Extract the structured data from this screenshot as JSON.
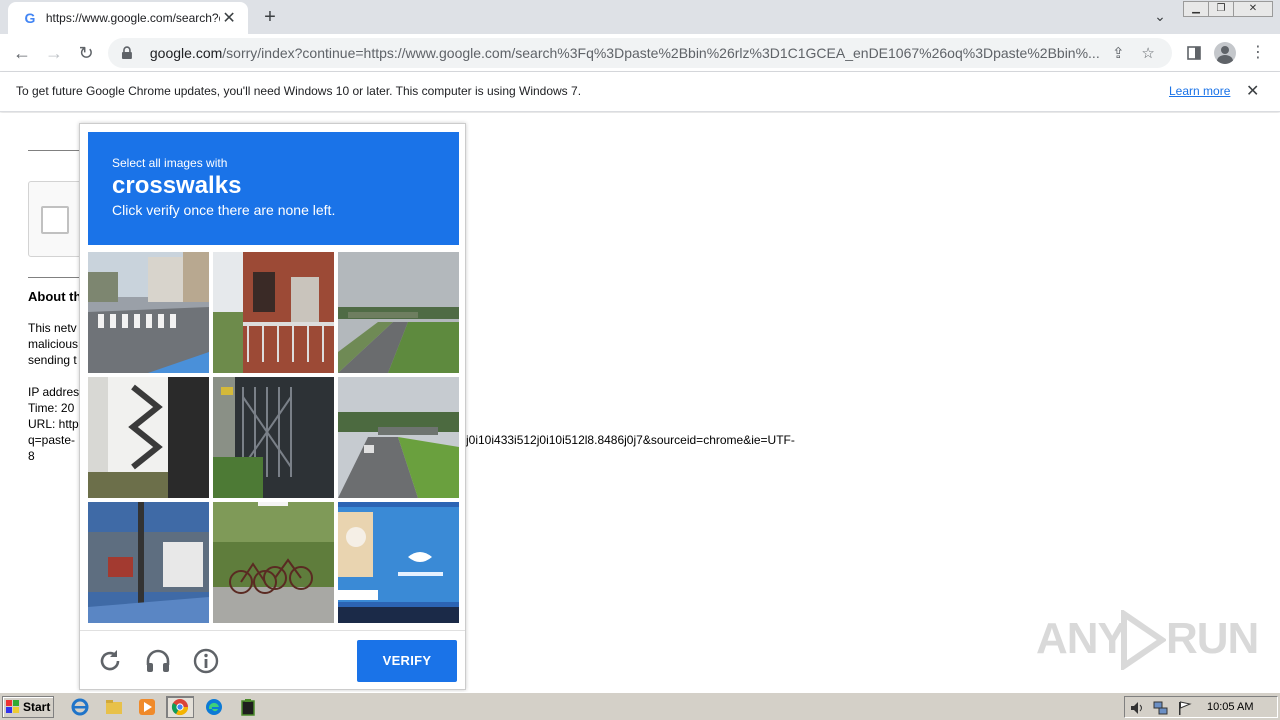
{
  "browser": {
    "tab": {
      "title": "https://www.google.com/search?q=",
      "favicon": "G"
    },
    "url": {
      "host": "google.com",
      "path": "/sorry/index?continue=https://www.google.com/search%3Fq%3Dpaste%2Bbin%26rlz%3D1C1GCEA_enDE1067%26oq%3Dpaste%2Bbin%..."
    },
    "window_controls": [
      "minimize-icon",
      "restore-icon",
      "close-icon"
    ]
  },
  "infobar": {
    "message": "To get future Google Chrome updates, you'll need Windows 10 or later. This computer is using Windows 7.",
    "link": "Learn more"
  },
  "background_page": {
    "about_heading": "About th",
    "lines": [
      "This netv",
      "malicious",
      "sending t"
    ],
    "ip_label": "IP addres",
    "time_label": "Time: 20",
    "url_label": "URL: http",
    "url_line2_left": "q=paste-",
    "url_line2_right": "j0i10i433i512j0i10i512l8.8486j0j7&sourceid=chrome&ie=UTF-",
    "url_line3": "8"
  },
  "challenge": {
    "instruction": "Select all images with",
    "keyword": "crosswalks",
    "subtext": "Click verify once there are none left.",
    "tiles": [
      "street-crosswalk",
      "brick-building-balcony",
      "highway-overpass",
      "building-exterior-stairs",
      "metal-gate",
      "highway-road",
      "street-with-truck",
      "parked-bicycles",
      "delivery-truck"
    ],
    "verify_label": "VERIFY"
  },
  "watermark": {
    "text_left": "ANY",
    "text_right": "RUN"
  },
  "taskbar": {
    "start_label": "Start",
    "clock": "10:05 AM",
    "apps": [
      "ie-icon",
      "explorer-icon",
      "media-player-icon",
      "chrome-icon",
      "edge-icon",
      "terminal-icon"
    ]
  },
  "colors": {
    "accent": "#1a73e8",
    "header_bg": "#dee1e6",
    "taskbar_bg": "#d4d0c8"
  }
}
